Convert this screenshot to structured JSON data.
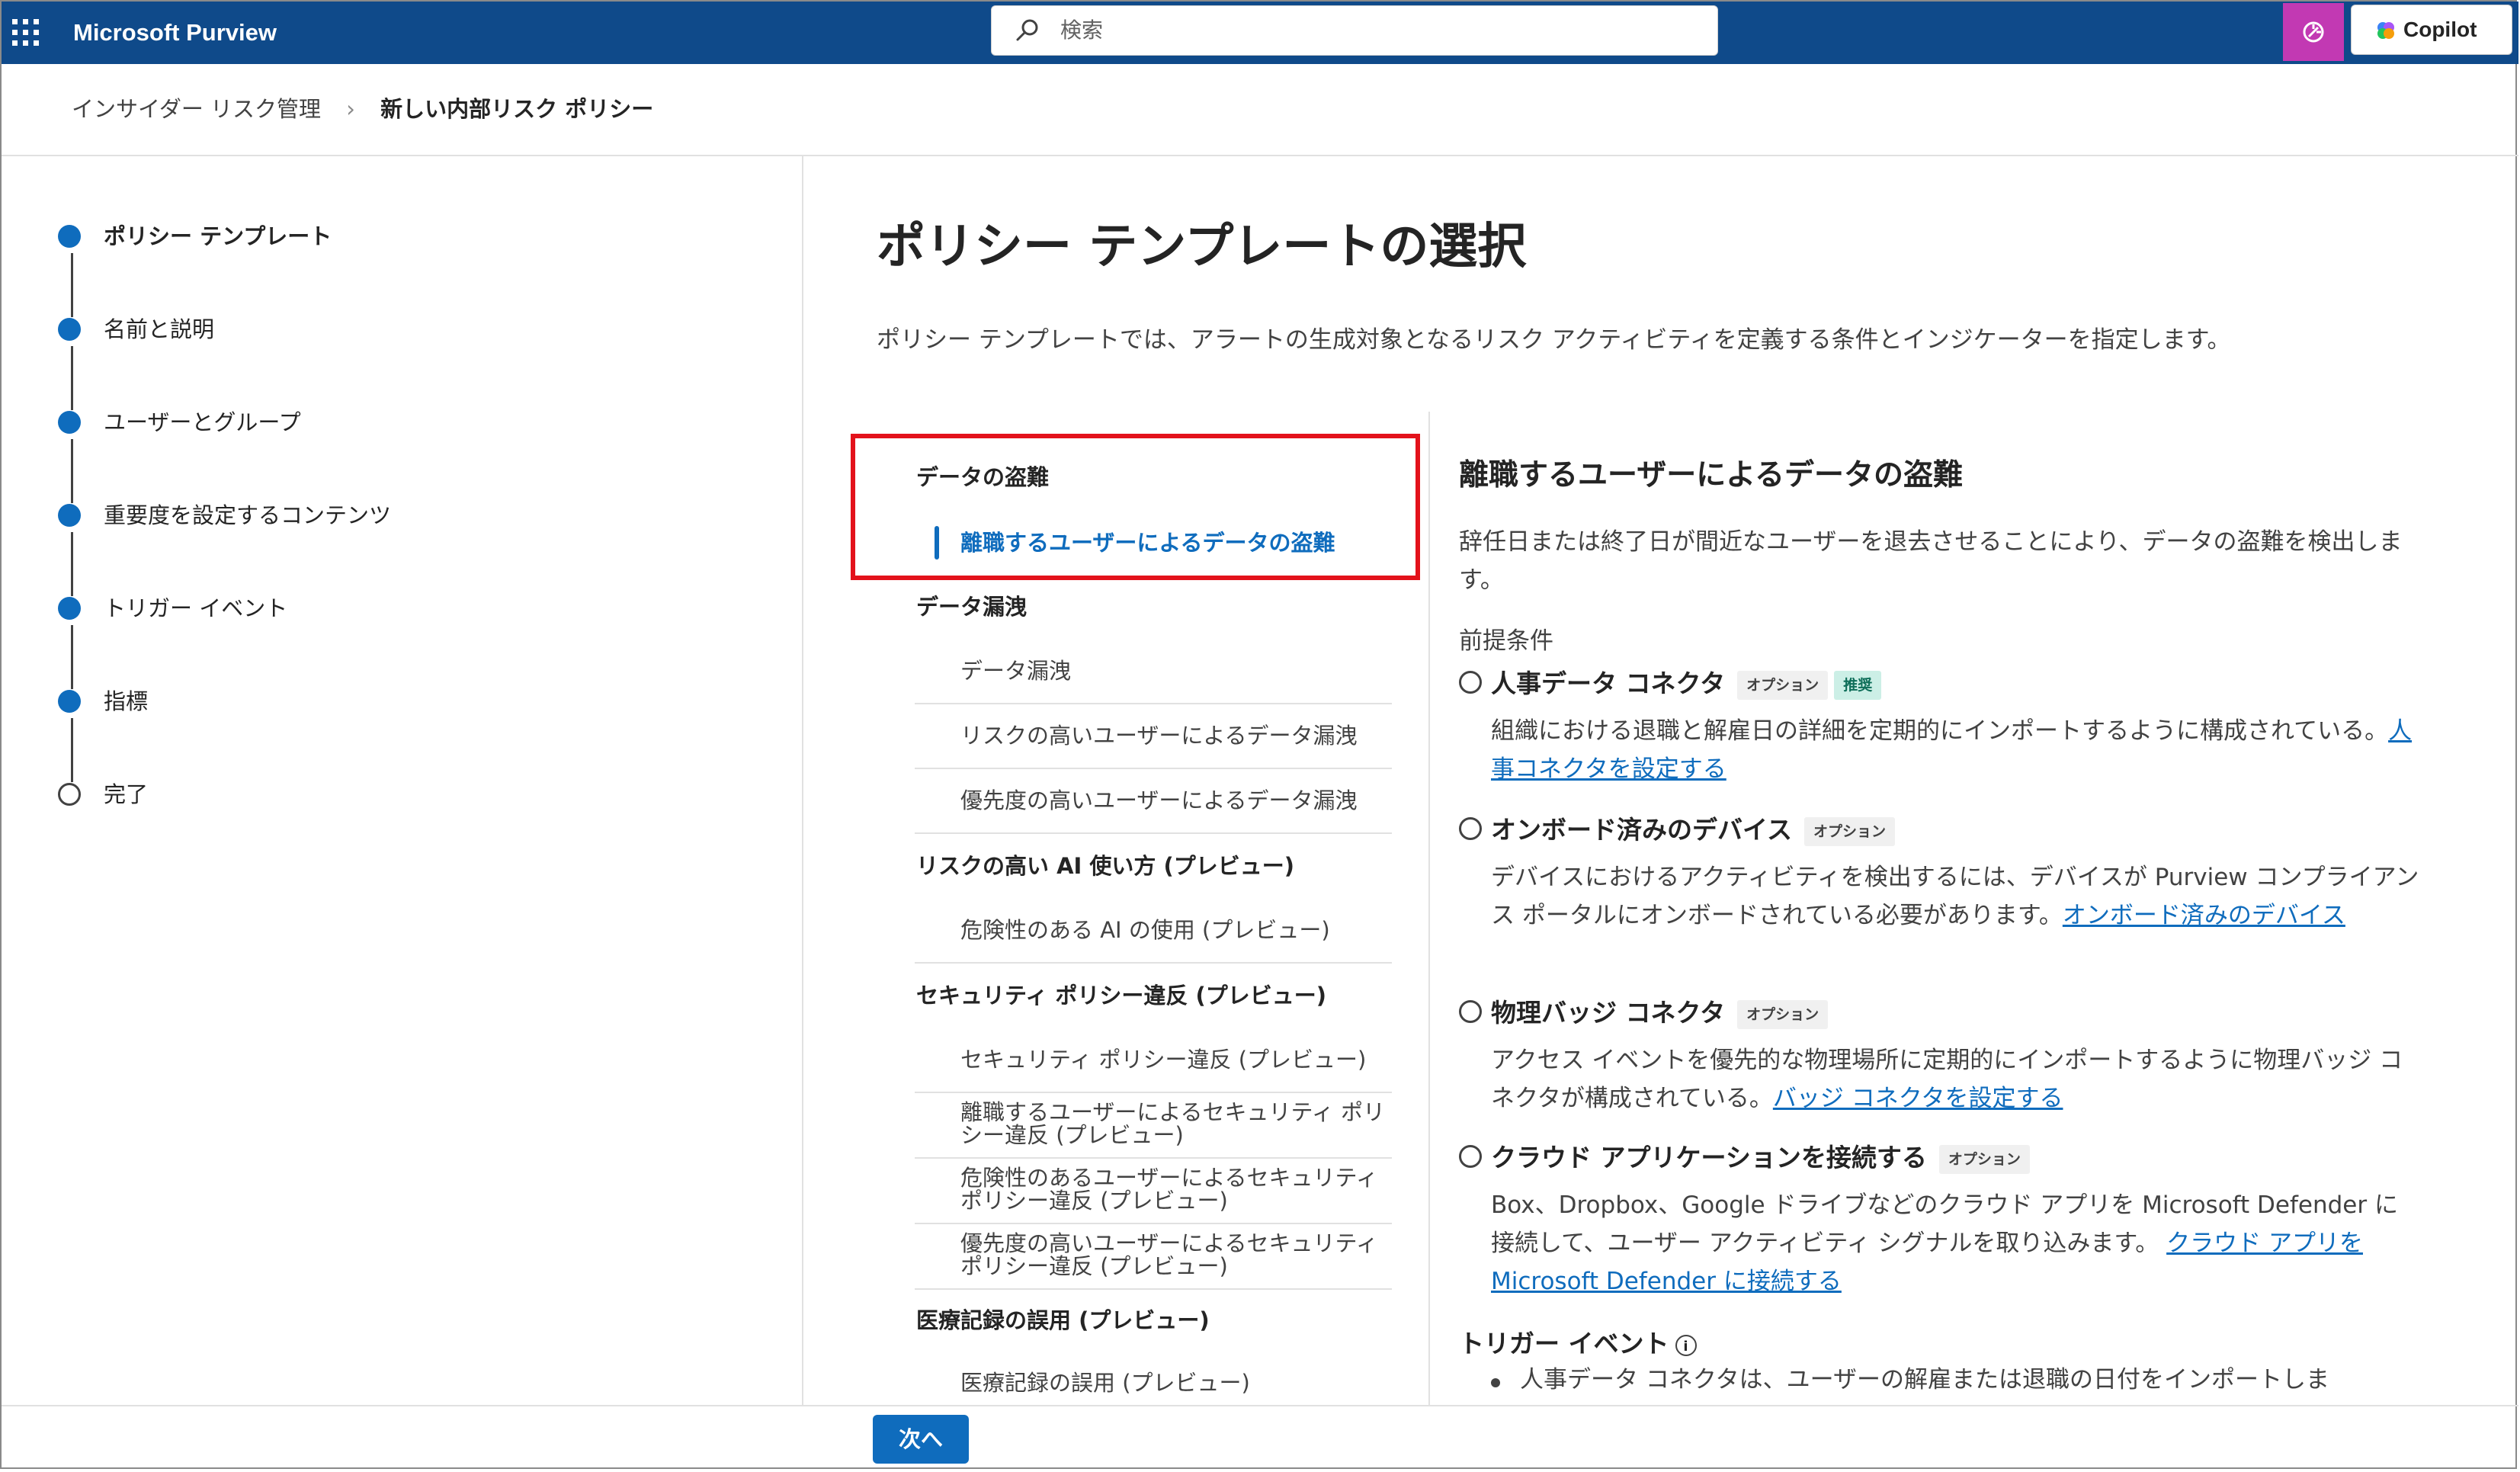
{
  "app": {
    "title": "Microsoft Purview",
    "copilot_label": "Copilot"
  },
  "search": {
    "placeholder": "検索"
  },
  "breadcrumb": {
    "parent": "インサイダー リスク管理",
    "current": "新しい内部リスク ポリシー"
  },
  "steps": [
    {
      "label": "ポリシー テンプレート",
      "state": "current"
    },
    {
      "label": "名前と説明",
      "state": "todo"
    },
    {
      "label": "ユーザーとグループ",
      "state": "todo"
    },
    {
      "label": "重要度を設定するコンテンツ",
      "state": "todo"
    },
    {
      "label": "トリガー イベント",
      "state": "todo"
    },
    {
      "label": "指標",
      "state": "todo"
    },
    {
      "label": "完了",
      "state": "todo"
    }
  ],
  "main": {
    "title": "ポリシー テンプレートの選択",
    "description": "ポリシー テンプレートでは、アラートの生成対象となるリスク アクティビティを定義する条件とインジケーターを指定します。"
  },
  "templates": {
    "cat_theft": "データの盗難",
    "item_departing_theft": "離職するユーザーによるデータの盗難",
    "cat_leak": "データ漏洩",
    "item_leak": "データ漏洩",
    "item_risky_leak": "リスクの高いユーザーによるデータ漏洩",
    "item_priority_leak": "優先度の高いユーザーによるデータ漏洩",
    "cat_ai": "リスクの高い AI 使い方 (プレビュー)",
    "item_ai": "危険性のある AI の使用 (プレビュー)",
    "cat_security": "セキュリティ ポリシー違反 (プレビュー)",
    "item_security": "セキュリティ ポリシー違反 (プレビュー)",
    "item_security_departing": "離職するユーザーによるセキュリティ ポリシー違反 (プレビュー)",
    "item_security_risky": "危険性のあるユーザーによるセキュリティ ポリシー違反 (プレビュー)",
    "item_security_priority": "優先度の高いユーザーによるセキュリティ ポリシー違反 (プレビュー)",
    "cat_health": "医療記録の誤用 (プレビュー)",
    "item_health": "医療記録の誤用 (プレビュー)"
  },
  "details": {
    "title": "離職するユーザーによるデータの盗難",
    "description": "辞任日または終了日が間近なユーザーを退去させることにより、データの盗難を検出します。",
    "prereq_heading": "前提条件",
    "badge_optional": "オプション",
    "badge_recommended": "推奨",
    "hr_title": "人事データ コネクタ",
    "hr_text": "組織における退職と解雇日の詳細を定期的にインポートするように構成されている。",
    "hr_link": "人事コネクタを設定する",
    "device_title": "オンボード済みのデバイス",
    "device_text": "デバイスにおけるアクティビティを検出するには、デバイスが Purview コンプライアンス ポータルにオンボードされている必要があります。",
    "device_link": "オンボード済みのデバイス",
    "badge_title": "物理バッジ コネクタ",
    "badge_text": "アクセス イベントを優先的な物理場所に定期的にインポートするように物理バッジ コネクタが構成されている。",
    "badge_link": "バッジ コネクタを設定する",
    "cloud_title": "クラウド アプリケーションを接続する",
    "cloud_text": "Box、Dropbox、Google ドライブなどのクラウド アプリを Microsoft Defender に接続して、ユーザー アクティビティ シグナルを取り込みます。",
    "cloud_link": "クラウド アプリを Microsoft Defender に接続する",
    "trigger_heading": "トリガー イベント",
    "trigger_bullet": "人事データ コネクタは、ユーザーの解雇または退職の日付をインポートしま"
  },
  "footer": {
    "next_label": "次へ"
  },
  "colors": {
    "header": "#0f4a8a",
    "accent": "#0f6cbd",
    "highlight_box": "#e3121b",
    "copilot_pink": "#c239b3"
  }
}
